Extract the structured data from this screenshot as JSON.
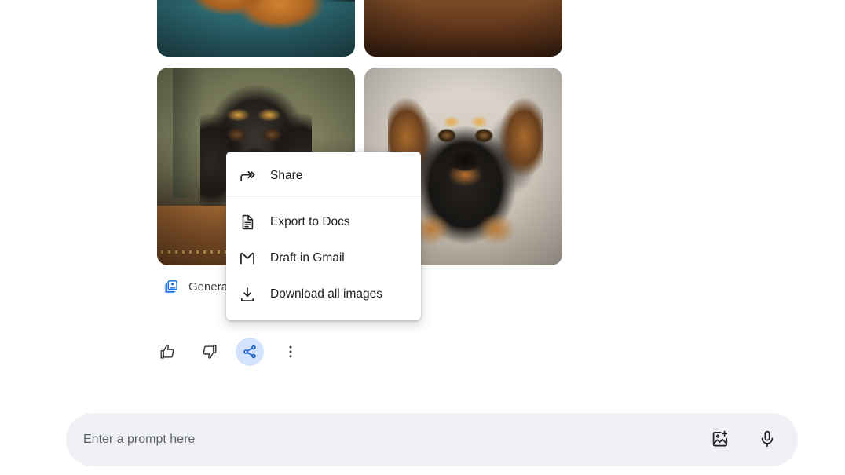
{
  "results": {
    "images": [
      {
        "alt_name": "dog-paws-on-teal-couch"
      },
      {
        "alt_name": "dachshund-on-brown-leather-sofa"
      },
      {
        "alt_name": "dachshund-on-ottoman-green-wall"
      },
      {
        "alt_name": "dachshund-closeup-on-light-sofa"
      }
    ],
    "generated_label": "Generated images",
    "generated_icon": "generated-images-icon"
  },
  "feedback": {
    "thumbs_up_label": "Good response",
    "thumbs_up_icon": "thumb-up-icon",
    "thumbs_down_label": "Bad response",
    "thumbs_down_icon": "thumb-down-icon",
    "share_label": "Share & export",
    "share_icon": "share-icon",
    "more_label": "More",
    "more_icon": "more-vert-icon",
    "active_item": "share",
    "active_bg": "#d3e3fd",
    "active_fg": "#1a5fd0"
  },
  "context_menu": {
    "items": [
      {
        "label": "Share",
        "icon": "forward-arrow-icon"
      },
      {
        "label": "Export to Docs",
        "icon": "document-icon"
      },
      {
        "label": "Draft in Gmail",
        "icon": "gmail-icon"
      },
      {
        "label": "Download all images",
        "icon": "download-icon"
      }
    ]
  },
  "prompt_bar": {
    "placeholder": "Enter a prompt here",
    "value": "",
    "add_image_label": "Add image",
    "add_image_icon": "add-image-icon",
    "mic_label": "Use microphone",
    "mic_icon": "microphone-icon",
    "background": "#eff1f5"
  }
}
